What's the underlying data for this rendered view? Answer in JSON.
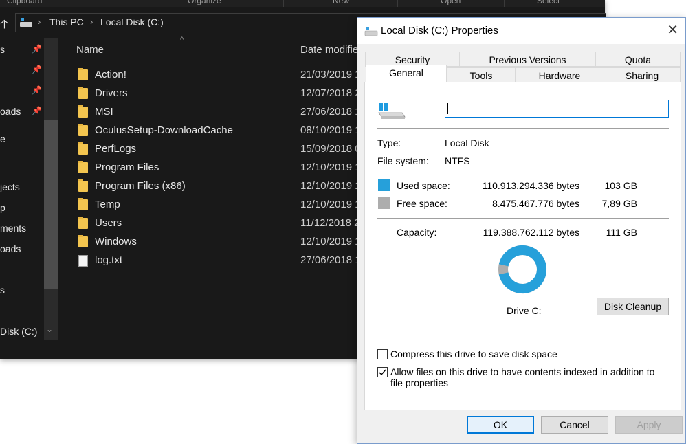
{
  "explorer": {
    "ribbon_groups": [
      "Clipboard",
      "Organize",
      "New",
      "Open",
      "Select"
    ],
    "breadcrumb": [
      "This PC",
      "Local Disk (C:)"
    ],
    "nav_items": [
      "s",
      "oads",
      "e",
      "jects",
      "p",
      "ments",
      "oads",
      "s",
      "Disk (C:)"
    ],
    "columns": {
      "name": "Name",
      "date": "Date modified"
    },
    "files": [
      {
        "name": "Action!",
        "date": "21/03/2019 1",
        "type": "folder"
      },
      {
        "name": "Drivers",
        "date": "12/07/2018 2",
        "type": "folder"
      },
      {
        "name": "MSI",
        "date": "27/06/2018 1",
        "type": "folder"
      },
      {
        "name": "OculusSetup-DownloadCache",
        "date": "08/10/2019 1",
        "type": "folder"
      },
      {
        "name": "PerfLogs",
        "date": "15/09/2018 0",
        "type": "folder"
      },
      {
        "name": "Program Files",
        "date": "12/10/2019 1",
        "type": "folder"
      },
      {
        "name": "Program Files (x86)",
        "date": "12/10/2019 1",
        "type": "folder"
      },
      {
        "name": "Temp",
        "date": "12/10/2019 1",
        "type": "folder"
      },
      {
        "name": "Users",
        "date": "11/12/2018 2",
        "type": "folder"
      },
      {
        "name": "Windows",
        "date": "12/10/2019 1",
        "type": "folder"
      },
      {
        "name": "log.txt",
        "date": "27/06/2018 1",
        "type": "file"
      }
    ]
  },
  "dialog": {
    "title": "Local Disk (C:) Properties",
    "tabs_back": [
      "Security",
      "Previous Versions",
      "Quota"
    ],
    "tabs_front": [
      "General",
      "Tools",
      "Hardware",
      "Sharing"
    ],
    "active_tab": "General",
    "name_value": "",
    "type_label": "Type:",
    "type_value": "Local Disk",
    "fs_label": "File system:",
    "fs_value": "NTFS",
    "used_label": "Used space:",
    "used_bytes": "110.913.294.336 bytes",
    "used_gb": "103 GB",
    "free_label": "Free space:",
    "free_bytes": "8.475.467.776 bytes",
    "free_gb": "7,89 GB",
    "capacity_label": "Capacity:",
    "capacity_bytes": "119.388.762.112 bytes",
    "capacity_gb": "111 GB",
    "used_fraction": 0.929,
    "used_color": "#26a0da",
    "free_color": "#adadad",
    "drive_label": "Drive C:",
    "cleanup_button": "Disk Cleanup",
    "compress_label": "Compress this drive to save disk space",
    "compress_checked": false,
    "index_label": "Allow files on this drive to have contents indexed in addition to file properties",
    "index_checked": true,
    "ok_button": "OK",
    "cancel_button": "Cancel",
    "apply_button": "Apply"
  }
}
